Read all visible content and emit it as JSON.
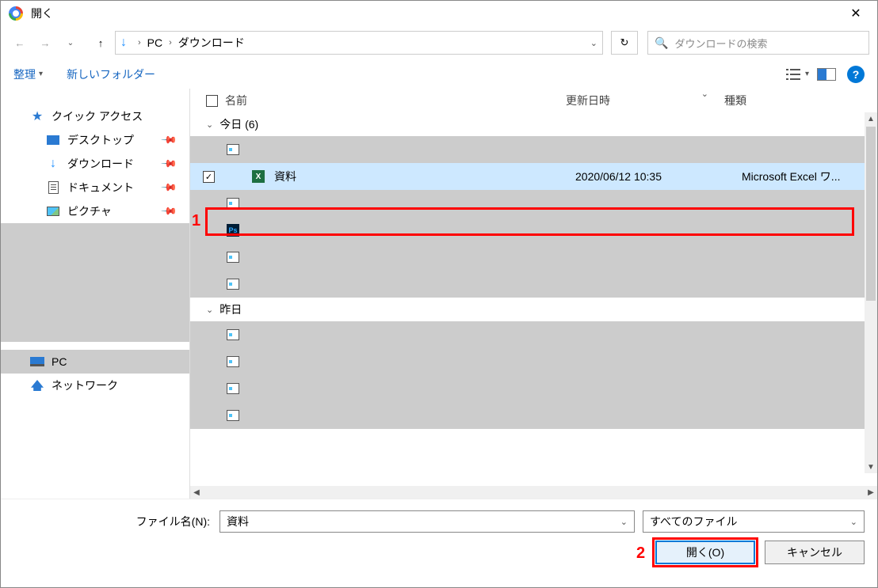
{
  "titlebar": {
    "title": "開く"
  },
  "navbar": {
    "crumb1": "PC",
    "crumb2": "ダウンロード"
  },
  "searchbox": {
    "placeholder": "ダウンロードの検索"
  },
  "toolbar": {
    "organize": "整理",
    "newfolder": "新しいフォルダー"
  },
  "sidebar": {
    "quick_access": "クイック アクセス",
    "desktop": "デスクトップ",
    "downloads": "ダウンロード",
    "documents": "ドキュメント",
    "pictures": "ピクチャ",
    "pc": "PC",
    "network": "ネットワーク"
  },
  "columns": {
    "name": "名前",
    "date": "更新日時",
    "type": "種類"
  },
  "groups": {
    "today": "今日 (6)",
    "yesterday": "昨日"
  },
  "selected_file": {
    "name": "資料",
    "date": "2020/06/12 10:35",
    "type": "Microsoft Excel ワ..."
  },
  "footer": {
    "filename_label": "ファイル名(N):",
    "filename_value": "資料",
    "filetype": "すべてのファイル",
    "open": "開く(O)",
    "cancel": "キャンセル"
  },
  "annotations": {
    "n1": "1",
    "n2": "2"
  }
}
